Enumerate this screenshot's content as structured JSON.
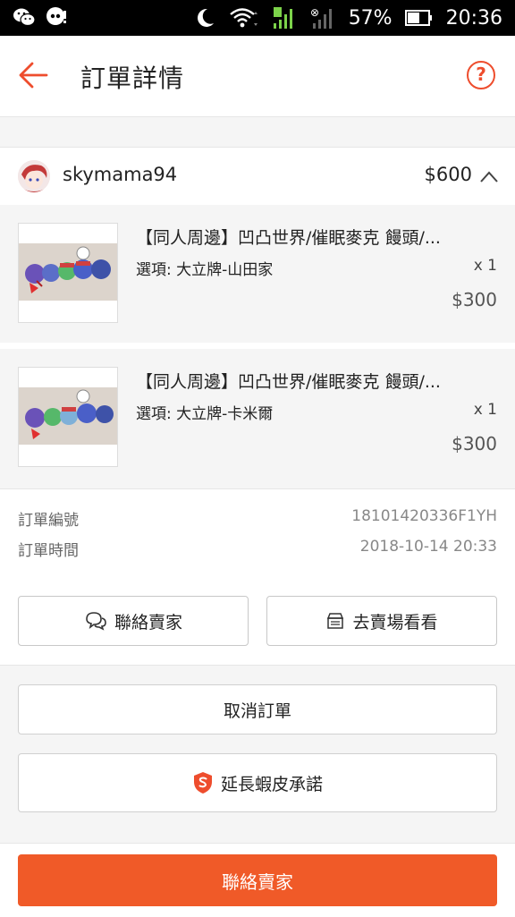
{
  "status_bar": {
    "battery": "57%",
    "time": "20:36"
  },
  "header": {
    "title": "訂單詳情"
  },
  "seller": {
    "name": "skymama94",
    "total": "$600"
  },
  "products": [
    {
      "name": "【同人周邊】凹凸世界/催眠麥克 饅頭/...",
      "option": "選項: 大立牌-山田家",
      "qty": "x 1",
      "price": "$300"
    },
    {
      "name": "【同人周邊】凹凸世界/催眠麥克 饅頭/...",
      "option": "選項: 大立牌-卡米爾",
      "qty": "x 1",
      "price": "$300"
    }
  ],
  "order_info": {
    "number_label": "訂單編號",
    "number_value": "18101420336F1YH",
    "time_label": "訂單時間",
    "time_value": "2018-10-14 20:33"
  },
  "actions": {
    "contact_seller": "聯絡賣家",
    "visit_shop": "去賣場看看",
    "cancel_order": "取消訂單",
    "extend_guarantee": "延長蝦皮承諾",
    "primary_contact": "聯絡賣家"
  },
  "colors": {
    "accent": "#ee4d2d",
    "primary_button": "#f05a28"
  }
}
